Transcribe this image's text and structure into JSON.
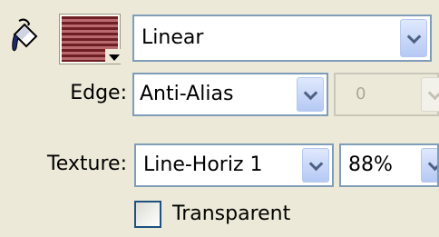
{
  "fill": {
    "icon": "paint-bucket-icon",
    "swatch_color": "#8b3a3f",
    "type_value": "Linear"
  },
  "edge": {
    "label": "Edge:",
    "value": "Anti-Alias",
    "amount_value": "0"
  },
  "texture": {
    "label": "Texture:",
    "value": "Line-Horiz 1",
    "amount_value": "88%"
  },
  "transparent": {
    "label": "Transparent",
    "checked": false
  }
}
